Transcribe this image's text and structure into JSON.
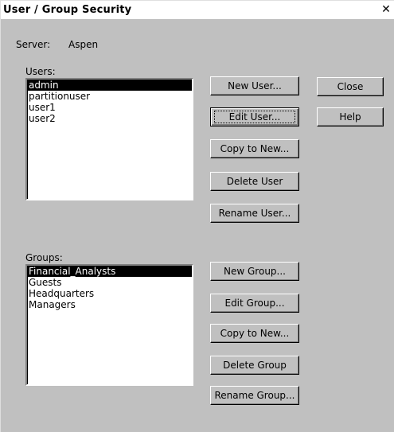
{
  "window": {
    "title": "User / Group Security",
    "close_glyph": "✕"
  },
  "server": {
    "label": "Server:",
    "name": "Aspen"
  },
  "users": {
    "label": "Users:",
    "items": [
      "admin",
      "partitionuser",
      "user1",
      "user2"
    ],
    "selected_index": 0
  },
  "groups": {
    "label": "Groups:",
    "items": [
      "Financial_Analysts",
      "Guests",
      "Headquarters",
      "Managers"
    ],
    "selected_index": 0
  },
  "user_buttons": {
    "new": "New User...",
    "edit": "Edit User...",
    "copy": "Copy to New...",
    "delete": "Delete User",
    "rename": "Rename User..."
  },
  "group_buttons": {
    "new": "New Group...",
    "edit": "Edit Group...",
    "copy": "Copy to New...",
    "delete": "Delete Group",
    "rename": "Rename Group..."
  },
  "dialog_buttons": {
    "close": "Close",
    "help": "Help"
  },
  "colors": {
    "face": "#c0c0c0",
    "selection_bg": "#000000",
    "selection_fg": "#ffffff"
  }
}
